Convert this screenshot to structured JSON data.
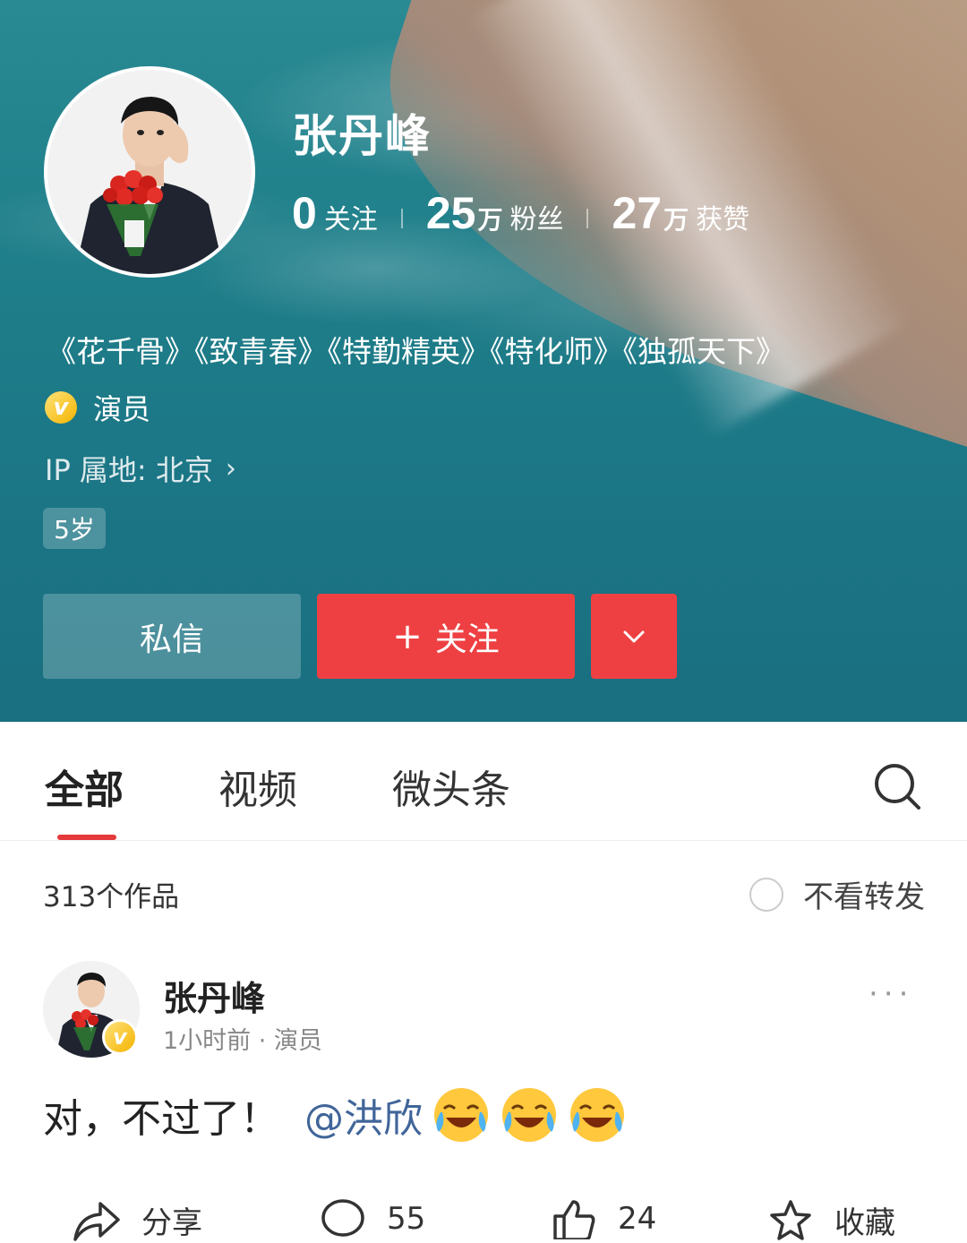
{
  "profile": {
    "name": "张丹峰",
    "stats": [
      {
        "num": "0",
        "unit": "",
        "label": "关注"
      },
      {
        "num": "25",
        "unit": "万",
        "label": "粉丝"
      },
      {
        "num": "27",
        "unit": "万",
        "label": "获赞"
      }
    ],
    "bio": "《花千骨》《致青春》《特勤精英》《特化师》《独孤天下》",
    "verify_badge": "v",
    "verify_label": "演员",
    "ip_location": "IP 属地: 北京",
    "ip_chevron": "›",
    "age_tag": "5岁",
    "buttons": {
      "message": "私信",
      "follow_plus": "+",
      "follow": "关注",
      "more_icon": "chevron-down-icon"
    }
  },
  "tabs": {
    "items": [
      "全部",
      "视频",
      "微头条"
    ],
    "active": "全部",
    "search_icon": "search-icon"
  },
  "filter": {
    "works_count": "313个作品",
    "hide_reposts": "不看转发"
  },
  "post": {
    "author": "张丹峰",
    "badge": "v",
    "meta": "1小时前 · 演员",
    "menu": "···",
    "text": "对，不过了！",
    "mention": "@洪欣",
    "emoji_icons": [
      "laugh-cry-emoji",
      "laugh-cry-emoji",
      "laugh-cry-emoji"
    ],
    "actions": {
      "share": "分享",
      "comments": "55",
      "likes": "24",
      "favorite": "收藏"
    }
  },
  "colors": {
    "accent_red": "#ee4042",
    "tab_indicator": "#e5393b",
    "mention": "#406599",
    "banner_teal": "#1f7f8a"
  }
}
